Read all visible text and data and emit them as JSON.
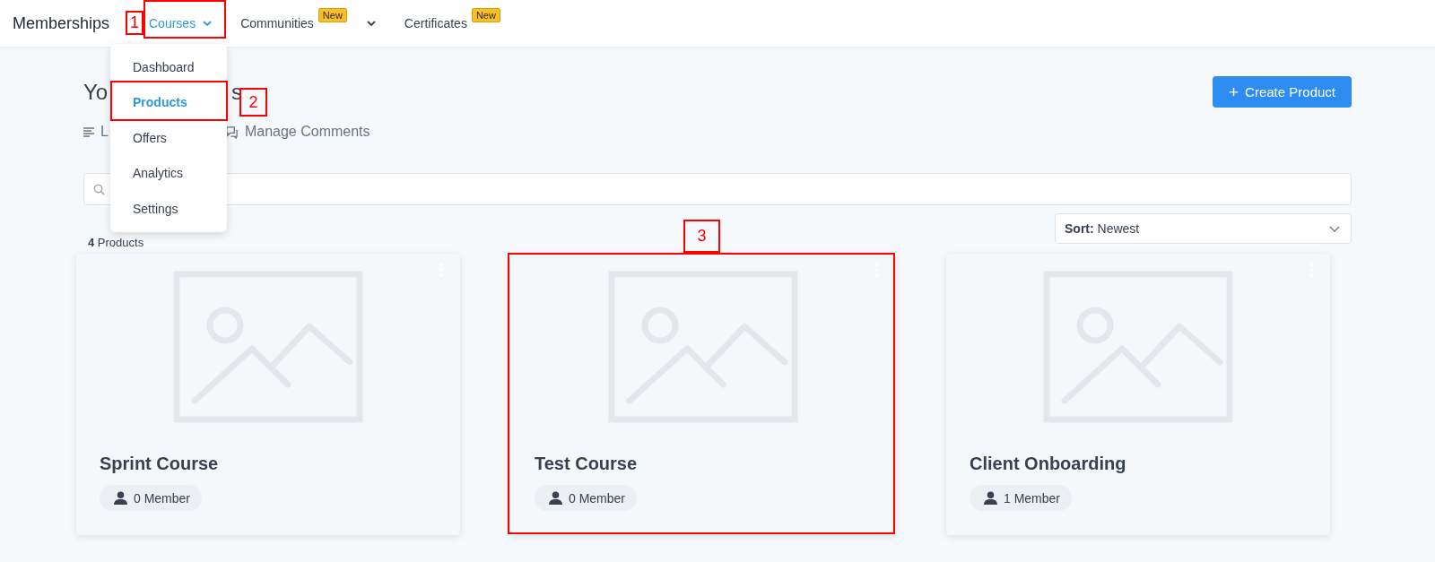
{
  "header": {
    "brand": "Memberships",
    "nav": [
      {
        "label": "Courses",
        "selected": true,
        "dropdown": true
      },
      {
        "label": "Communities",
        "selected": false,
        "badge": "New",
        "dropdown": true
      },
      {
        "label": "Certificates",
        "selected": false,
        "badge": "New"
      }
    ]
  },
  "menu": {
    "items": [
      {
        "label": "Dashboard",
        "selected": false
      },
      {
        "label": "Products",
        "selected": true
      },
      {
        "label": "Offers",
        "selected": false
      },
      {
        "label": "Analytics",
        "selected": false
      },
      {
        "label": "Settings",
        "selected": false
      }
    ]
  },
  "page": {
    "title_parts": [
      "Yo",
      "s"
    ],
    "tabs": [
      {
        "label": "L",
        "kind": "list"
      },
      {
        "label": "Manage Comments",
        "kind": "comments"
      }
    ],
    "create_button": {
      "icon": "+",
      "label": "Create Product"
    },
    "count": {
      "number": "4",
      "label": "Products"
    },
    "sort": {
      "label": "Sort:",
      "value": "Newest"
    }
  },
  "products": [
    {
      "name": "Sprint Course",
      "members": "0 Member"
    },
    {
      "name": "Test Course",
      "members": "0 Member"
    },
    {
      "name": "Client Onboarding",
      "members": "1 Member"
    }
  ],
  "annotations": [
    {
      "label": "1"
    },
    {
      "label": "2"
    },
    {
      "label": "3"
    }
  ]
}
